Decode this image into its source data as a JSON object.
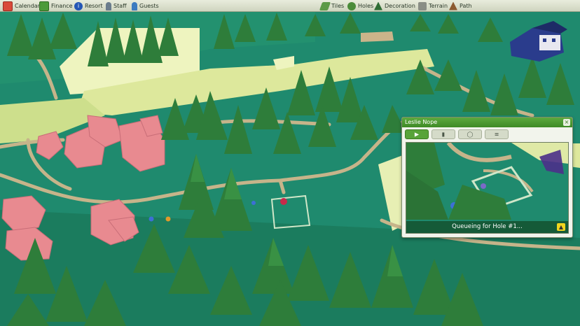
{
  "toolbar": {
    "left": [
      {
        "label": "Calendar",
        "icon": "calendar-icon"
      },
      {
        "label": "Finance",
        "icon": "money-icon"
      },
      {
        "label": "Resort",
        "icon": "info-icon"
      },
      {
        "label": "Staff",
        "icon": "staff-icon"
      },
      {
        "label": "Guests",
        "icon": "guests-icon"
      }
    ],
    "right": [
      {
        "label": "Tiles",
        "icon": "tiles-icon"
      },
      {
        "label": "Holes",
        "icon": "holes-icon"
      },
      {
        "label": "Decoration",
        "icon": "decoration-icon"
      },
      {
        "label": "Terrain",
        "icon": "terrain-icon"
      },
      {
        "label": "Path",
        "icon": "path-icon"
      }
    ]
  },
  "guest_panel": {
    "title": "Leslie Nope",
    "close_glyph": "×",
    "tabs": [
      {
        "name": "camera",
        "glyph": "▶"
      },
      {
        "name": "info",
        "glyph": "▮"
      },
      {
        "name": "thoughts",
        "glyph": "◯"
      },
      {
        "name": "stats",
        "glyph": "≡"
      }
    ],
    "status": "Queueing for Hole #1...",
    "status_button": "▲"
  },
  "colors": {
    "grass": "#1f8a6e",
    "fairway_light": "#e7efb4",
    "path": "#c8b68a",
    "tree": "#2e7d3a",
    "blossom": "#e88a90",
    "panel_green": "#4f9c33"
  }
}
